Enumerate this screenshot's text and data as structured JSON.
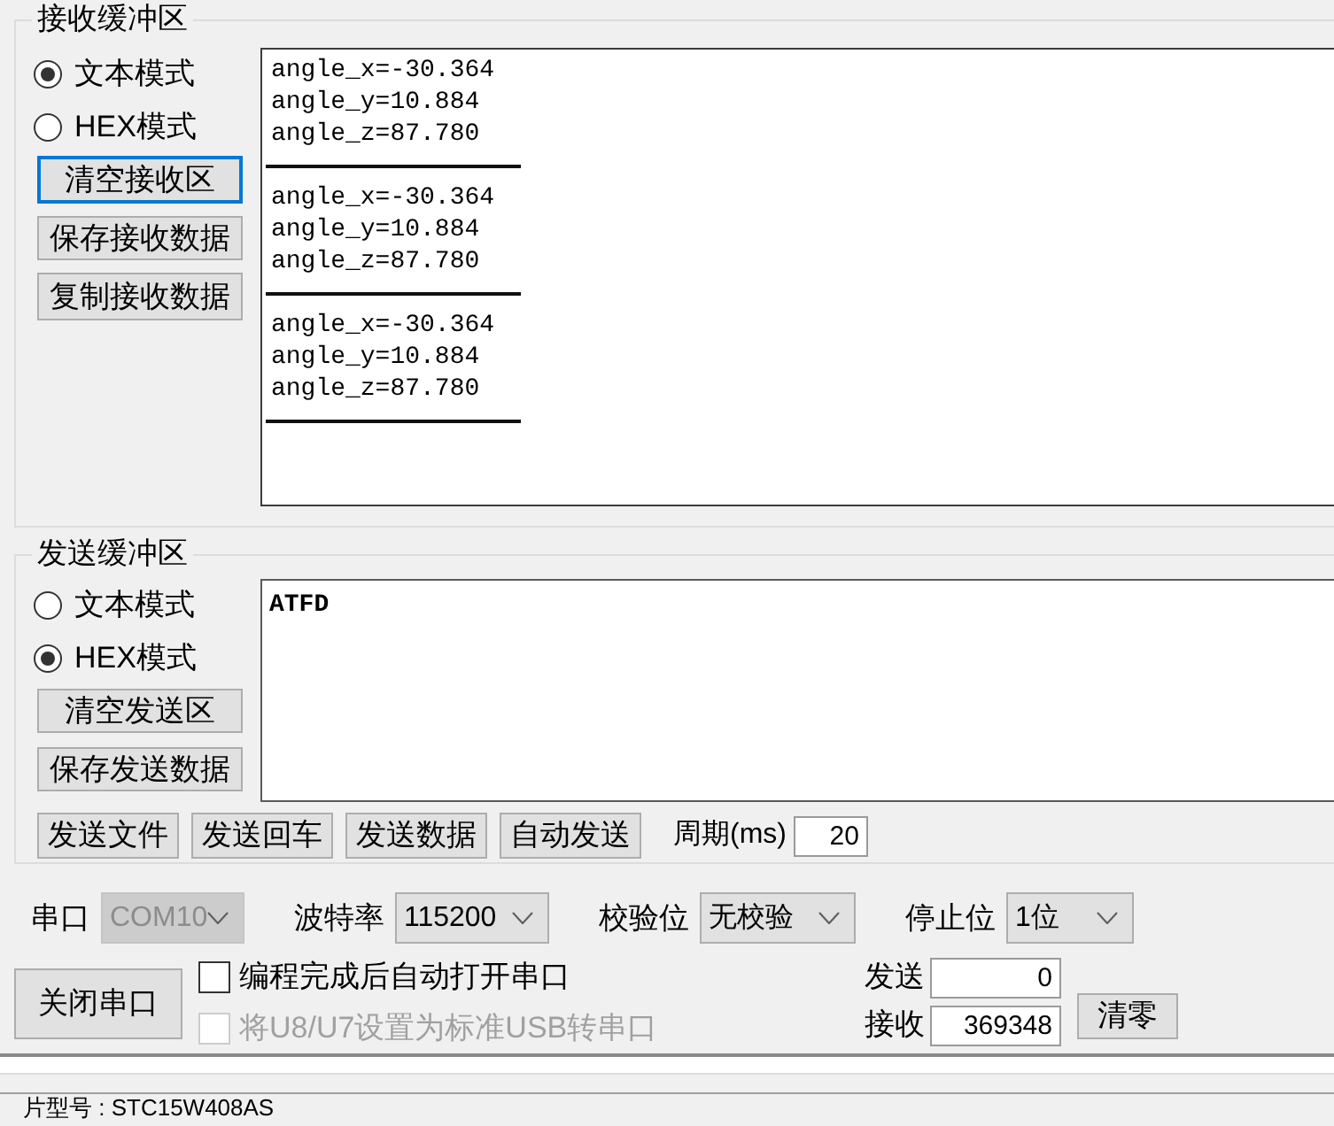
{
  "receive_buffer": {
    "title": "接收缓冲区",
    "modes": [
      {
        "label": "文本模式",
        "selected": true
      },
      {
        "label": "HEX模式",
        "selected": false
      }
    ],
    "buttons": [
      {
        "label": "清空接收区",
        "focused": true
      },
      {
        "label": "保存接收数据",
        "focused": false
      },
      {
        "label": "复制接收数据",
        "focused": false
      }
    ],
    "records": [
      {
        "lines": [
          "angle_x=-30.364",
          "angle_y=10.884",
          "angle_z=87.780"
        ]
      },
      {
        "lines": [
          "angle_x=-30.364",
          "angle_y=10.884",
          "angle_z=87.780"
        ]
      },
      {
        "lines": [
          "angle_x=-30.364",
          "angle_y=10.884",
          "angle_z=87.780"
        ]
      }
    ]
  },
  "send_buffer": {
    "title": "发送缓冲区",
    "modes": [
      {
        "label": "文本模式",
        "selected": false
      },
      {
        "label": "HEX模式",
        "selected": true
      }
    ],
    "buttons": [
      {
        "label": "清空发送区",
        "focused": false
      },
      {
        "label": "保存发送数据",
        "focused": false
      }
    ],
    "text": "ATFD",
    "actions": [
      "发送文件",
      "发送回车",
      "发送数据",
      "自动发送"
    ],
    "period": {
      "label": "周期(ms)",
      "value": "20"
    }
  },
  "serial_settings": [
    {
      "label": "串口",
      "value": "COM10",
      "disabled": true
    },
    {
      "label": "波特率",
      "value": "115200",
      "disabled": false
    },
    {
      "label": "校验位",
      "value": "无校验",
      "disabled": false
    },
    {
      "label": "停止位",
      "value": "1位",
      "disabled": false
    }
  ],
  "close_port_button": "关闭串口",
  "options": [
    {
      "label": "编程完成后自动打开串口",
      "checked": false,
      "disabled": false
    },
    {
      "label": "将U8/U7设置为标准USB转串口",
      "checked": false,
      "disabled": true
    }
  ],
  "counters": [
    {
      "label": "发送",
      "value": "0"
    },
    {
      "label": "接收",
      "value": "369348"
    }
  ],
  "clear_counters_button": "清零",
  "chip_model": "片型号 : STC15W408AS"
}
